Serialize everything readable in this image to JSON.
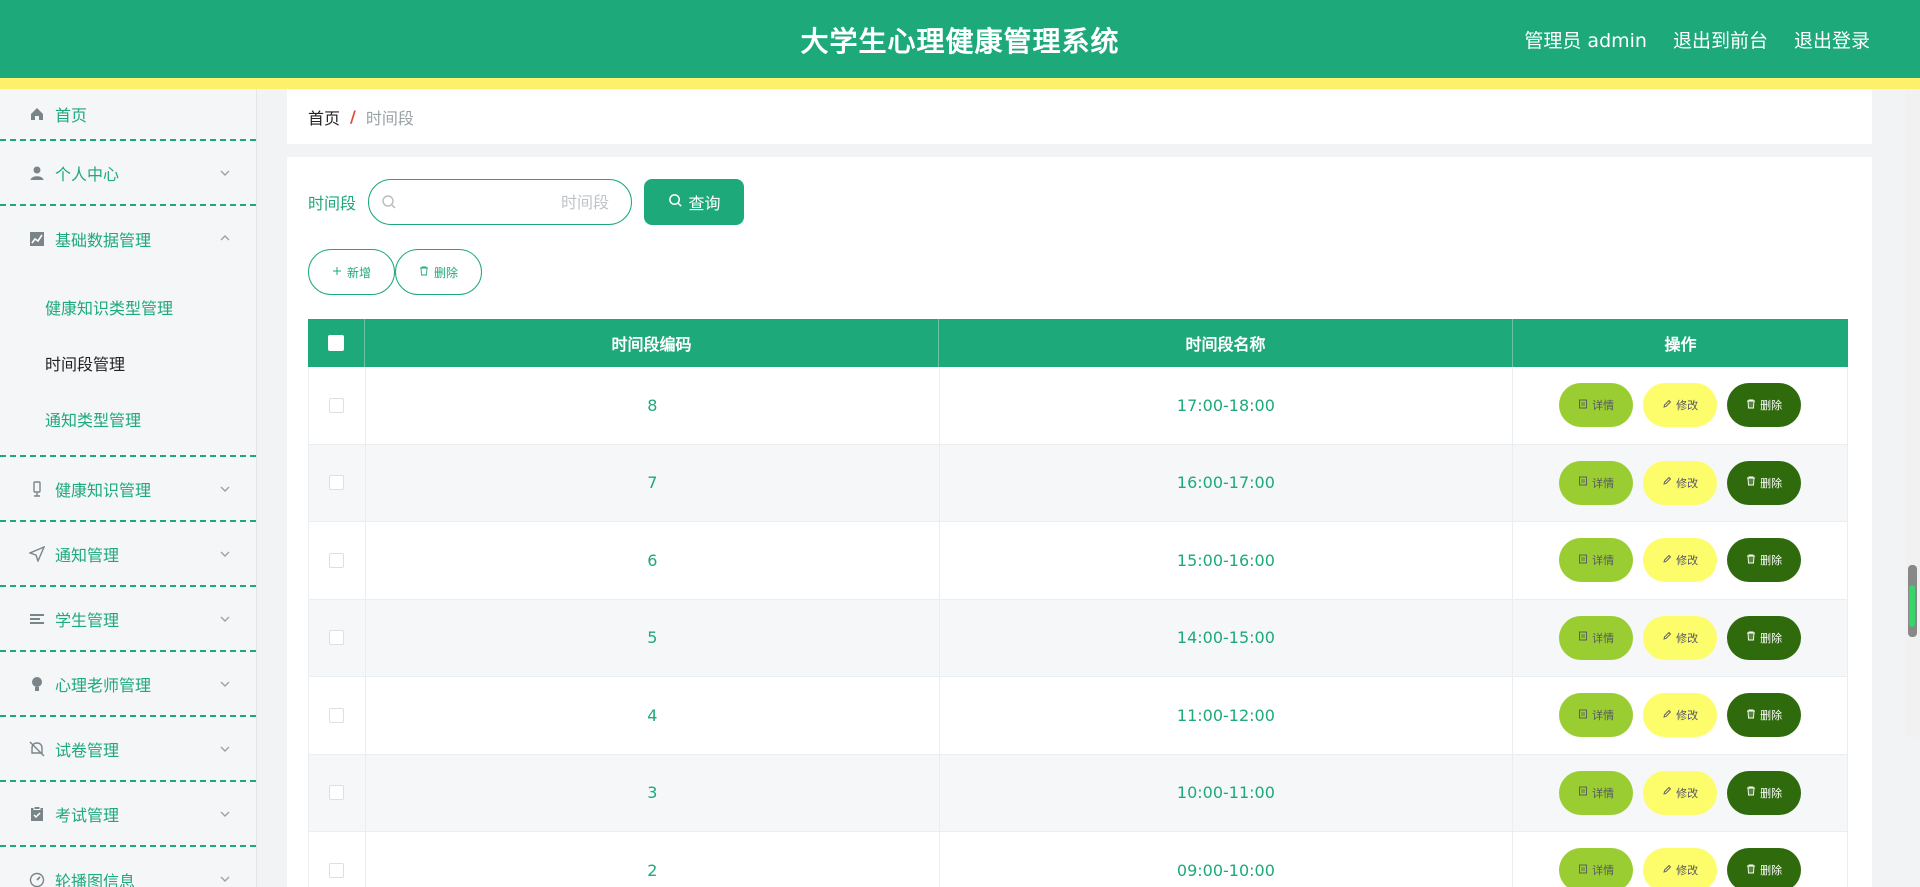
{
  "header": {
    "title": "大学生心理健康管理系统",
    "user_label": "管理员 admin",
    "front_link": "退出到前台",
    "logout_link": "退出登录"
  },
  "sidebar": {
    "items": [
      {
        "label": "首页",
        "icon": "home-icon"
      },
      {
        "label": "个人中心",
        "icon": "user-icon"
      },
      {
        "label": "基础数据管理",
        "icon": "chart-icon"
      },
      {
        "label": "健康知识管理",
        "icon": "mic-icon"
      },
      {
        "label": "通知管理",
        "icon": "send-icon"
      },
      {
        "label": "学生管理",
        "icon": "list-icon"
      },
      {
        "label": "心理老师管理",
        "icon": "bulb-icon"
      },
      {
        "label": "试卷管理",
        "icon": "bell-off-icon"
      },
      {
        "label": "考试管理",
        "icon": "clipboard-icon"
      },
      {
        "label": "轮播图信息",
        "icon": "gauge-icon"
      }
    ],
    "submenu": [
      {
        "label": "健康知识类型管理"
      },
      {
        "label": "时间段管理"
      },
      {
        "label": "通知类型管理"
      }
    ]
  },
  "breadcrumb": {
    "home": "首页",
    "separator": "/",
    "current": "时间段"
  },
  "search": {
    "label": "时间段",
    "placeholder": "时间段",
    "button": "查询"
  },
  "actions": {
    "add": "新增",
    "delete": "删除"
  },
  "table": {
    "headers": [
      "时间段编码",
      "时间段名称",
      "操作"
    ],
    "rows": [
      {
        "code": "8",
        "name": "17:00-18:00"
      },
      {
        "code": "7",
        "name": "16:00-17:00"
      },
      {
        "code": "6",
        "name": "15:00-16:00"
      },
      {
        "code": "5",
        "name": "14:00-15:00"
      },
      {
        "code": "4",
        "name": "11:00-12:00"
      },
      {
        "code": "3",
        "name": "10:00-11:00"
      },
      {
        "code": "2",
        "name": "09:00-10:00"
      }
    ],
    "row_actions": {
      "detail": "详情",
      "edit": "修改",
      "delete": "删除"
    }
  },
  "colors": {
    "primary": "#1ea97a",
    "stripe": "#fdf06b",
    "detail_btn": "#9acd32",
    "edit_btn": "#fdfd6b",
    "delete_btn": "#2f6b0c"
  }
}
